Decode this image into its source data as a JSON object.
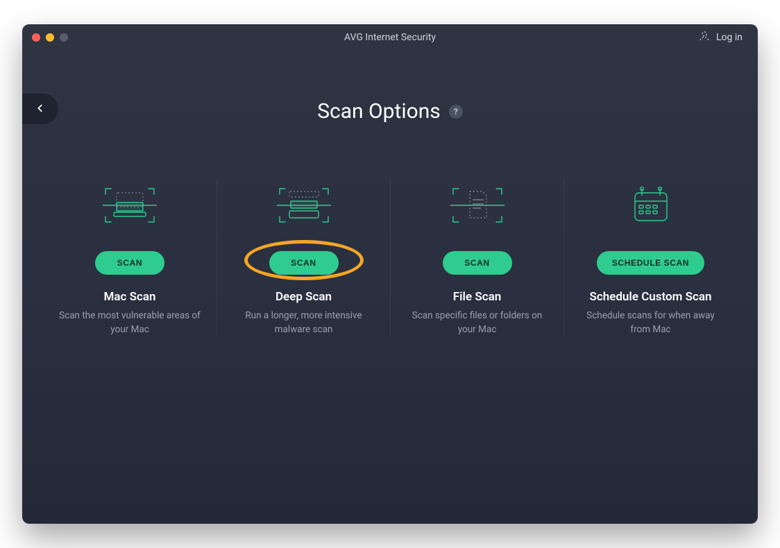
{
  "app": {
    "title": "AVG Internet Security",
    "login_label": "Log in"
  },
  "page": {
    "title": "Scan Options",
    "help_symbol": "?"
  },
  "options": [
    {
      "button_label": "SCAN",
      "title": "Mac Scan",
      "description": "Scan the most vulnerable areas of your Mac",
      "icon": "scan-mac-icon",
      "highlighted": false
    },
    {
      "button_label": "SCAN",
      "title": "Deep Scan",
      "description": "Run a longer, more intensive malware scan",
      "icon": "scan-deep-icon",
      "highlighted": true
    },
    {
      "button_label": "SCAN",
      "title": "File Scan",
      "description": "Scan specific files or folders on your Mac",
      "icon": "scan-file-icon",
      "highlighted": false
    },
    {
      "button_label": "SCHEDULE SCAN",
      "title": "Schedule Custom Scan",
      "description": "Schedule scans for when away from Mac",
      "icon": "schedule-scan-icon",
      "highlighted": false
    }
  ],
  "colors": {
    "accent_green": "#2ecc8f",
    "highlight_orange": "#f5a623",
    "bg_top": "#2e3442",
    "bg_bottom": "#242938"
  }
}
